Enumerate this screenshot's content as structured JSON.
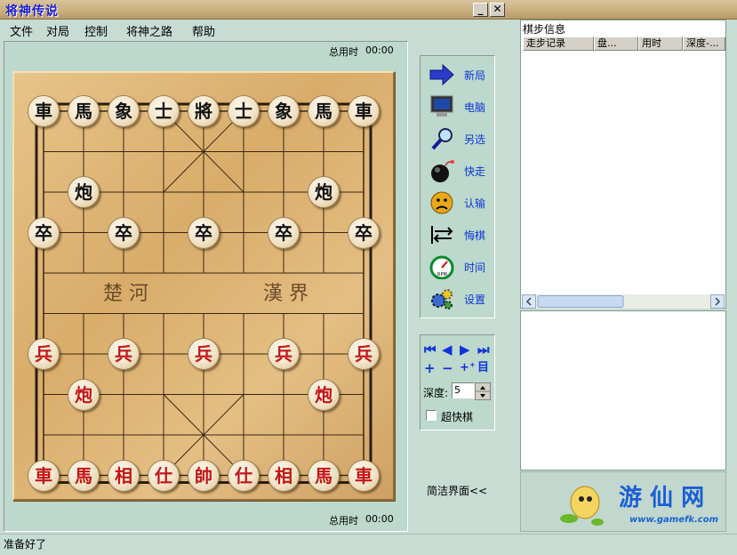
{
  "window": {
    "title": "将神传说",
    "minimize_label": "_",
    "close_label": "✕"
  },
  "menu": [
    "文件",
    "对局",
    "控制",
    "将神之路",
    "帮助"
  ],
  "board": {
    "total_time_label": "总用时",
    "top_time": "00:00",
    "bottom_time": "00:00",
    "river_left": "楚 河",
    "river_right": "漢 界",
    "pieces": [
      {
        "t": "車",
        "c": "black",
        "f": 0,
        "r": 0
      },
      {
        "t": "馬",
        "c": "black",
        "f": 1,
        "r": 0
      },
      {
        "t": "象",
        "c": "black",
        "f": 2,
        "r": 0
      },
      {
        "t": "士",
        "c": "black",
        "f": 3,
        "r": 0
      },
      {
        "t": "將",
        "c": "black",
        "f": 4,
        "r": 0
      },
      {
        "t": "士",
        "c": "black",
        "f": 5,
        "r": 0
      },
      {
        "t": "象",
        "c": "black",
        "f": 6,
        "r": 0
      },
      {
        "t": "馬",
        "c": "black",
        "f": 7,
        "r": 0
      },
      {
        "t": "車",
        "c": "black",
        "f": 8,
        "r": 0
      },
      {
        "t": "炮",
        "c": "black",
        "f": 1,
        "r": 2
      },
      {
        "t": "炮",
        "c": "black",
        "f": 7,
        "r": 2
      },
      {
        "t": "卒",
        "c": "black",
        "f": 0,
        "r": 3
      },
      {
        "t": "卒",
        "c": "black",
        "f": 2,
        "r": 3
      },
      {
        "t": "卒",
        "c": "black",
        "f": 4,
        "r": 3
      },
      {
        "t": "卒",
        "c": "black",
        "f": 6,
        "r": 3
      },
      {
        "t": "卒",
        "c": "black",
        "f": 8,
        "r": 3
      },
      {
        "t": "兵",
        "c": "red",
        "f": 0,
        "r": 6
      },
      {
        "t": "兵",
        "c": "red",
        "f": 2,
        "r": 6
      },
      {
        "t": "兵",
        "c": "red",
        "f": 4,
        "r": 6
      },
      {
        "t": "兵",
        "c": "red",
        "f": 6,
        "r": 6
      },
      {
        "t": "兵",
        "c": "red",
        "f": 8,
        "r": 6
      },
      {
        "t": "炮",
        "c": "red",
        "f": 1,
        "r": 7
      },
      {
        "t": "炮",
        "c": "red",
        "f": 7,
        "r": 7
      },
      {
        "t": "車",
        "c": "red",
        "f": 0,
        "r": 9
      },
      {
        "t": "馬",
        "c": "red",
        "f": 1,
        "r": 9
      },
      {
        "t": "相",
        "c": "red",
        "f": 2,
        "r": 9
      },
      {
        "t": "仕",
        "c": "red",
        "f": 3,
        "r": 9
      },
      {
        "t": "帥",
        "c": "red",
        "f": 4,
        "r": 9
      },
      {
        "t": "仕",
        "c": "red",
        "f": 5,
        "r": 9
      },
      {
        "t": "相",
        "c": "red",
        "f": 6,
        "r": 9
      },
      {
        "t": "馬",
        "c": "red",
        "f": 7,
        "r": 9
      },
      {
        "t": "車",
        "c": "red",
        "f": 8,
        "r": 9
      }
    ]
  },
  "toolbar": [
    {
      "label": "新局",
      "icon": "arrow-icon"
    },
    {
      "label": "电脑",
      "icon": "monitor-icon"
    },
    {
      "label": "另选",
      "icon": "magnifier-icon"
    },
    {
      "label": "快走",
      "icon": "bomb-icon"
    },
    {
      "label": "认输",
      "icon": "sad-face-icon"
    },
    {
      "label": "悔棋",
      "icon": "undo-arrows-icon"
    },
    {
      "label": "时间",
      "icon": "clock-gauge-icon"
    },
    {
      "label": "设置",
      "icon": "gears-icon"
    }
  ],
  "nav": {
    "buttons_row1": [
      "⏮",
      "◀",
      "▶",
      "⏭"
    ],
    "buttons_row2": [
      "+",
      "−",
      "+⁺",
      "目"
    ],
    "depth_label": "深度:",
    "depth_value": "5",
    "superfast_label": "超快棋"
  },
  "simple_ui_label": "简洁界面<<",
  "moves": {
    "title": "棋步信息",
    "columns": [
      "走步记录",
      "盘...",
      "用时",
      "深度-..."
    ]
  },
  "logo": {
    "text": "游 仙 网",
    "url": "www.gamefk.com"
  },
  "status": "准备好了",
  "colors": {
    "accent": "#0a36d6",
    "red_piece": "#c41414",
    "background": "#c7dcd3"
  }
}
